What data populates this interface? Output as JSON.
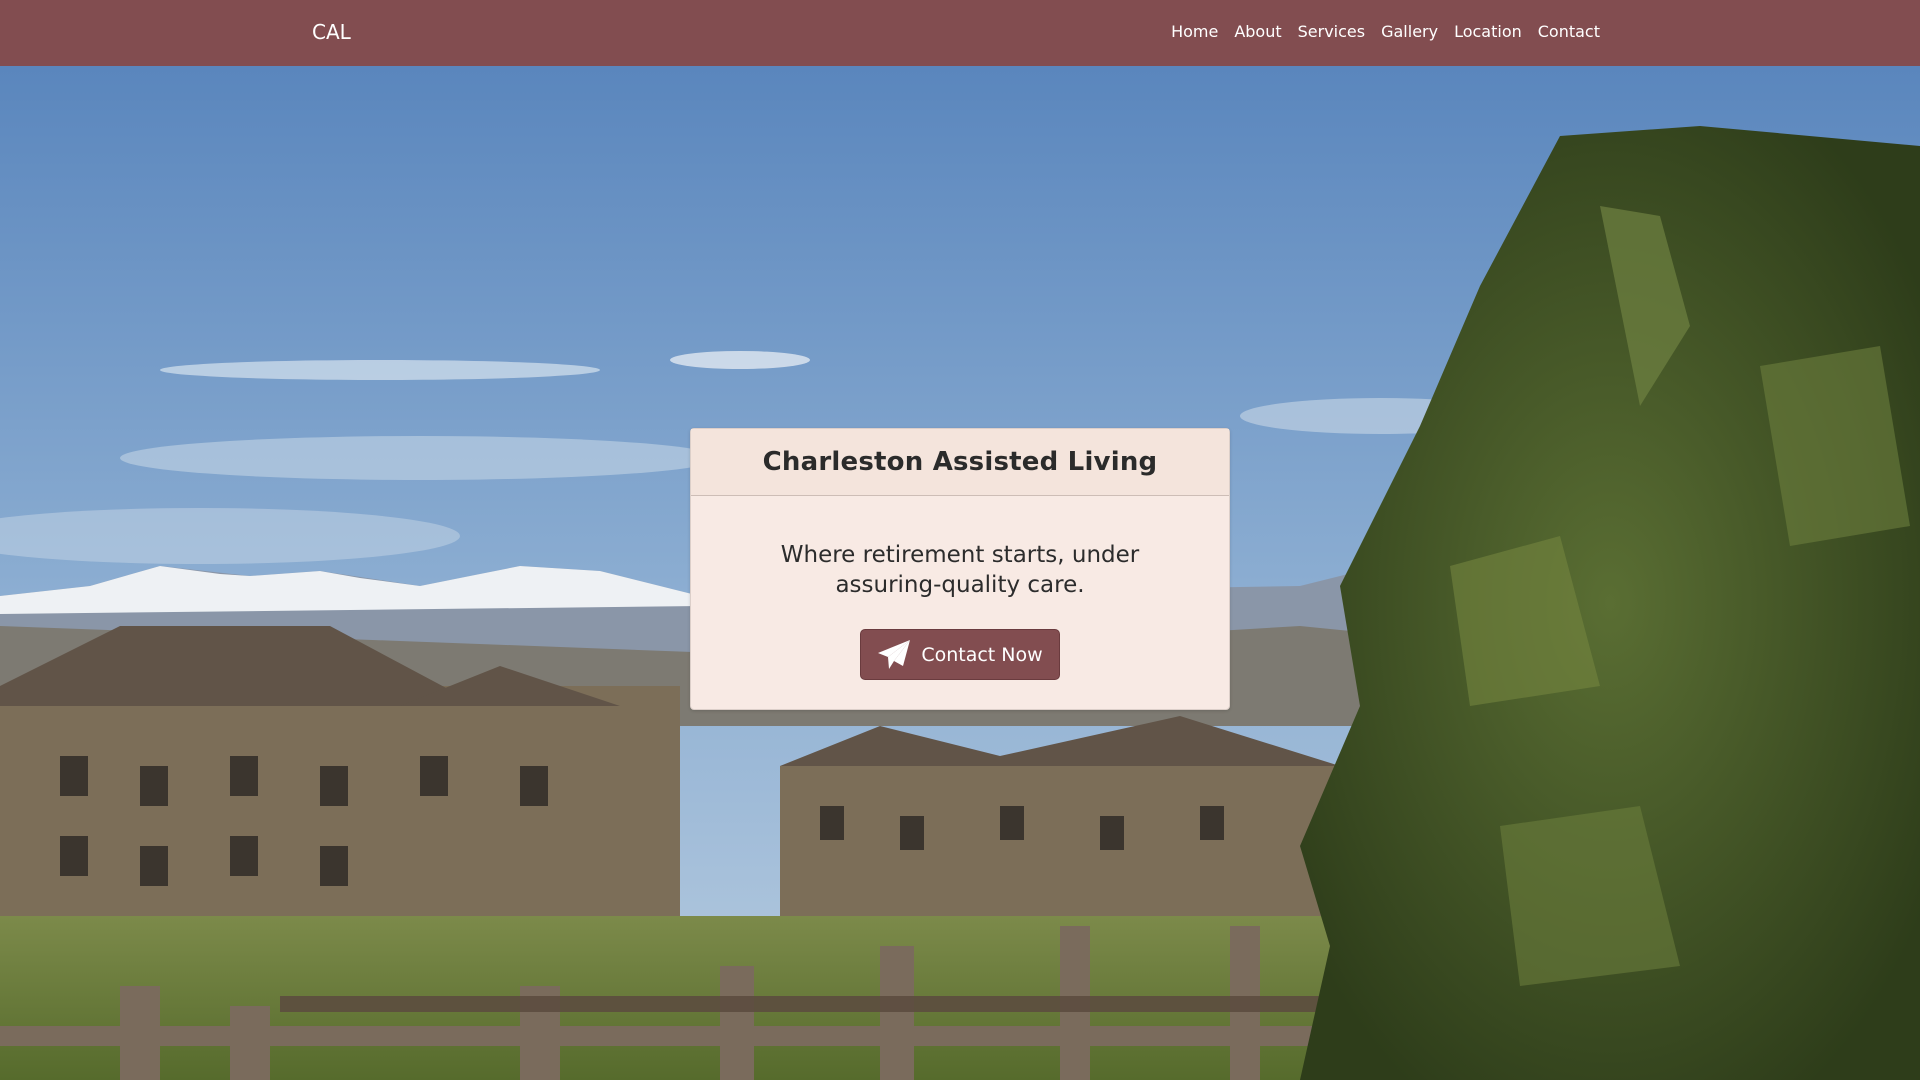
{
  "navbar": {
    "brand": "CAL",
    "links": [
      "Home",
      "About",
      "Services",
      "Gallery",
      "Location",
      "Contact"
    ]
  },
  "hero": {
    "title": "Charleston Assisted Living",
    "tagline": "Where retirement starts, under assuring-quality care.",
    "cta_label": "Contact Now",
    "cta_icon": "paper-plane-icon"
  },
  "colors": {
    "navbar_bg": "#824d50",
    "card_bg": "#f8eae4",
    "card_header_bg": "#f4e4dc",
    "button_bg": "#824d50"
  }
}
